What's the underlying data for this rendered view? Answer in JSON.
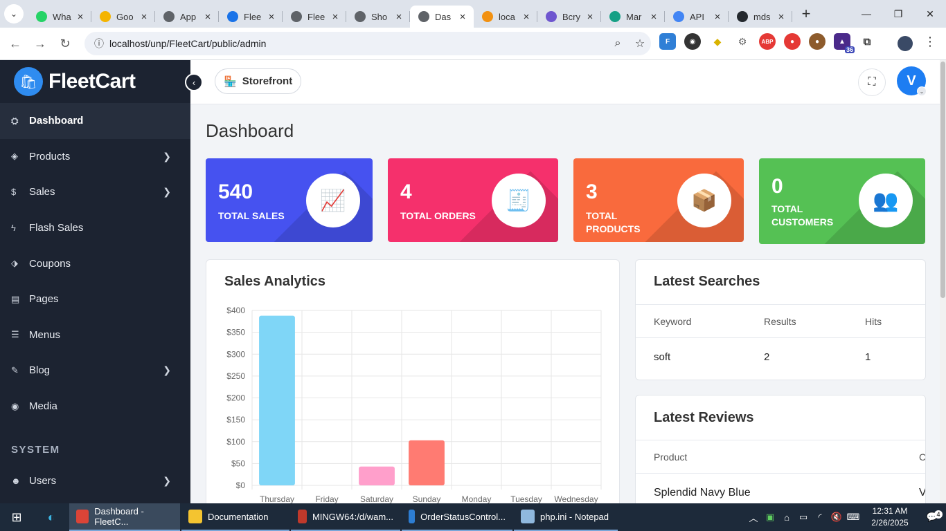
{
  "browser": {
    "tabs": [
      {
        "label": "Wha",
        "color": "#25d366"
      },
      {
        "label": "Goo",
        "color": "#f4b400"
      },
      {
        "label": "App",
        "color": "#5f6368"
      },
      {
        "label": "Flee",
        "color": "#1a73e8"
      },
      {
        "label": "Flee",
        "color": "#5f6368"
      },
      {
        "label": "Sho",
        "color": "#5f6368"
      },
      {
        "label": "Das",
        "color": "#5f6368"
      },
      {
        "label": "loca",
        "color": "#f29111"
      },
      {
        "label": "Bcry",
        "color": "#6e56cf"
      },
      {
        "label": "Mar",
        "color": "#16a085"
      },
      {
        "label": "API",
        "color": "#4285f4"
      },
      {
        "label": "mds",
        "color": "#24292e"
      }
    ],
    "url": "localhost/unp/FleetCart/public/admin",
    "ext_badge": "36"
  },
  "app": {
    "brand": "FleetCart",
    "storefront_label": "Storefront",
    "avatar_letter": "V",
    "page_title": "Dashboard",
    "nav": [
      {
        "label": "Dashboard",
        "icon": "⛭",
        "active": true,
        "chevron": false
      },
      {
        "label": "Products",
        "icon": "◈",
        "active": false,
        "chevron": true
      },
      {
        "label": "Sales",
        "icon": "$",
        "active": false,
        "chevron": true
      },
      {
        "label": "Flash Sales",
        "icon": "ϟ",
        "active": false,
        "chevron": false
      },
      {
        "label": "Coupons",
        "icon": "⬗",
        "active": false,
        "chevron": false
      },
      {
        "label": "Pages",
        "icon": "▤",
        "active": false,
        "chevron": false
      },
      {
        "label": "Menus",
        "icon": "☰",
        "active": false,
        "chevron": false
      },
      {
        "label": "Blog",
        "icon": "✎",
        "active": false,
        "chevron": true
      },
      {
        "label": "Media",
        "icon": "◉",
        "active": false,
        "chevron": false
      }
    ],
    "system_label": "SYSTEM",
    "system_nav": [
      {
        "label": "Users",
        "icon": "☻",
        "chevron": true
      }
    ],
    "cards": [
      {
        "value": "540",
        "label": "TOTAL SALES",
        "color": "#4652f0",
        "icon": "📈"
      },
      {
        "value": "4",
        "label": "TOTAL ORDERS",
        "color": "#f5306c",
        "icon": "🧾"
      },
      {
        "value": "3",
        "label": "TOTAL PRODUCTS",
        "color": "#f96a3d",
        "icon": "📦"
      },
      {
        "value": "0",
        "label": "TOTAL CUSTOMERS",
        "color": "#55c154",
        "icon": "👥"
      }
    ],
    "sales_analytics_title": "Sales Analytics",
    "latest_searches": {
      "title": "Latest Searches",
      "columns": [
        "Keyword",
        "Results",
        "Hits"
      ],
      "rows": [
        [
          "soft",
          "2",
          "1"
        ]
      ]
    },
    "latest_reviews": {
      "title": "Latest Reviews",
      "columns": [
        "Product",
        "C"
      ],
      "rows": [
        [
          "Splendid Navy Blue",
          "V"
        ]
      ]
    }
  },
  "chart_data": {
    "type": "bar",
    "title": "Sales Analytics",
    "categories": [
      "Thursday",
      "Friday",
      "Saturday",
      "Sunday",
      "Monday",
      "Tuesday",
      "Wednesday"
    ],
    "values": [
      388,
      0,
      43,
      103,
      0,
      0,
      0
    ],
    "colors": [
      "#7fd6f7",
      "#ffffff",
      "#ff9fcb",
      "#ff7b72",
      "#ffffff",
      "#ffffff",
      "#ffffff"
    ],
    "ylim": [
      0,
      400
    ],
    "yticks": [
      "$0",
      "$50",
      "$100",
      "$150",
      "$200",
      "$250",
      "$300",
      "$350",
      "$400"
    ],
    "grid": true
  },
  "taskbar": {
    "apps": [
      {
        "label": "Dashboard - FleetC...",
        "color": "#db4437",
        "active": true
      },
      {
        "label": "Documentation",
        "color": "#f4c430",
        "active": false
      },
      {
        "label": "MINGW64:/d/wam...",
        "color": "#c0392b",
        "active": false
      },
      {
        "label": "OrderStatusControl...",
        "color": "#2d7dd2",
        "active": false
      },
      {
        "label": "php.ini - Notepad",
        "color": "#8fb8de",
        "active": false
      }
    ],
    "time": "12:31 AM",
    "date": "2/26/2025",
    "notif_count": "4"
  }
}
